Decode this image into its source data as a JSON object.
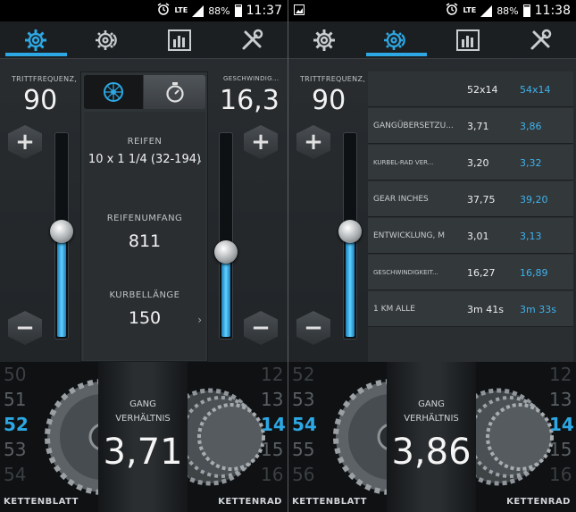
{
  "status": {
    "lte": "LTE",
    "battery": "88%",
    "left_time": "11:37",
    "right_time": "11:38"
  },
  "left": {
    "cadence_label": "TRITTFREQUENZ,",
    "cadence_value": "90",
    "speed_label": "GESCHWINDIG...",
    "speed_value": "16,3",
    "cadence_slider_level": 0.52,
    "speed_slider_level": 0.42,
    "tire_label": "REIFEN",
    "tire_value": "10 x 1 1/4 (32-194)",
    "circumference_label": "REIFENUMFANG",
    "circumference_value": "811",
    "crank_label": "KURBELLÄNGE",
    "crank_value": "150",
    "chainring": [
      "50",
      "51",
      "52",
      "53",
      "54"
    ],
    "sprocket": [
      "12",
      "13",
      "14",
      "15",
      "16"
    ],
    "ratio_label_1": "GANG",
    "ratio_label_2": "VERHÄLTNIS",
    "ratio_value": "3,71",
    "chainring_label": "KETTENBLATT",
    "sprocket_label": "KETTENRAD"
  },
  "right": {
    "cadence_label": "TRITTFREQUENZ,",
    "cadence_value": "90",
    "cadence_slider_level": 0.52,
    "table": {
      "header": [
        "",
        "52x14",
        "54x14"
      ],
      "rows": [
        [
          "GANGÜBERSETZU...",
          "3,71",
          "3,86"
        ],
        [
          "KURBEL-RAD VER...",
          "3,20",
          "3,32"
        ],
        [
          "GEAR INCHES",
          "37,75",
          "39,20"
        ],
        [
          "ENTWICKLUNG, M",
          "3,01",
          "3,13"
        ],
        [
          "GESCHWINDIGKEIT...",
          "16,27",
          "16,89"
        ],
        [
          "1 KM ALLE",
          "3m 41s",
          "3m 33s"
        ]
      ]
    },
    "chainring": [
      "52",
      "53",
      "54",
      "55",
      "56"
    ],
    "sprocket": [
      "12",
      "13",
      "14",
      "15",
      "16"
    ],
    "ratio_label_1": "GANG",
    "ratio_label_2": "VERHÄLTNIS",
    "ratio_value": "3,86",
    "chainring_label": "KETTENBLATT",
    "sprocket_label": "KETTENRAD"
  },
  "colors": {
    "accent": "#2da8e4",
    "background": "#25292c"
  }
}
